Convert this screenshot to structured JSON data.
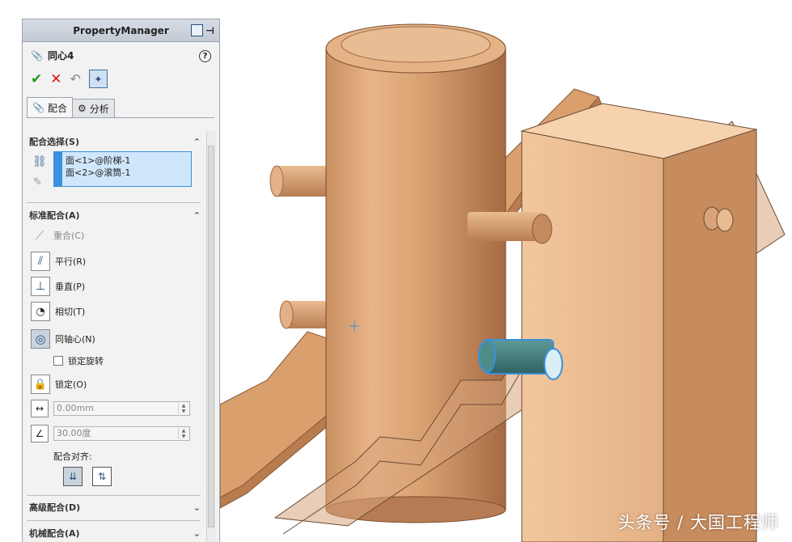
{
  "panel": {
    "title": "PropertyManager",
    "feature_name": "同心4",
    "help": "?",
    "tabs": [
      {
        "label": "配合",
        "active": true
      },
      {
        "label": "分析",
        "active": false
      }
    ]
  },
  "mate_selections": {
    "heading": "配合选择(S)",
    "items": [
      "面<1>@阶梯-1",
      "面<2>@滚筒-1"
    ]
  },
  "standard_mates": {
    "heading": "标准配合(A)",
    "coincident": "重合(C)",
    "parallel": "平行(R)",
    "perpendicular": "垂直(P)",
    "tangent": "相切(T)",
    "concentric": "同轴心(N)",
    "lock_rotation": "锁定旋转",
    "lock_rotation_checked": false,
    "lock": "锁定(O)",
    "distance_value": "0.00mm",
    "angle_value": "30.00度",
    "alignment_label": "配合对齐:"
  },
  "advanced_mates": {
    "heading": "高级配合(D)"
  },
  "mechanical_mates": {
    "heading": "机械配合(A)"
  },
  "watermark": "头条号 / 大国工程师",
  "colors": {
    "wood_light": "#e8b488",
    "wood_mid": "#d19a6c",
    "wood_dark": "#b57b52",
    "selection_blue": "#3c90dc",
    "ok_green": "#1d9a1d",
    "cancel_red": "#d11111"
  }
}
